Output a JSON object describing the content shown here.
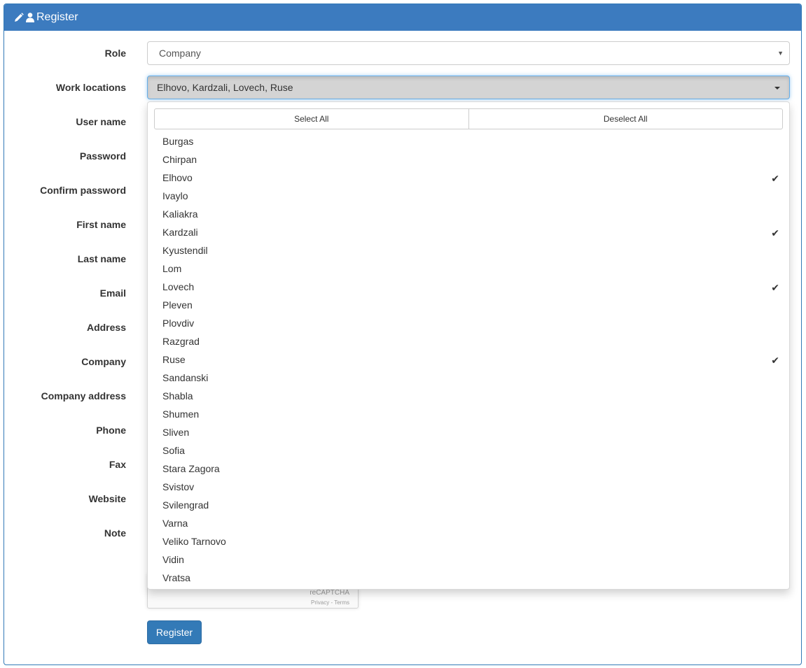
{
  "header": {
    "title": "Register",
    "icons": [
      "pencil-icon",
      "user-icon"
    ]
  },
  "form": {
    "role": {
      "label": "Role",
      "value": "Company"
    },
    "work_locations": {
      "label": "Work locations",
      "value": "Elhovo, Kardzali, Lovech, Ruse"
    },
    "labels": {
      "user_name": "User name",
      "password": "Password",
      "confirm_password": "Confirm password",
      "first_name": "First name",
      "last_name": "Last name",
      "email": "Email",
      "address": "Address",
      "company": "Company",
      "company_address": "Company address",
      "phone": "Phone",
      "fax": "Fax",
      "website": "Website",
      "note": "Note"
    },
    "submit_label": "Register"
  },
  "dropdown": {
    "select_all": "Select All",
    "deselect_all": "Deselect All",
    "options": [
      {
        "label": "Burgas",
        "selected": false
      },
      {
        "label": "Chirpan",
        "selected": false
      },
      {
        "label": "Elhovo",
        "selected": true
      },
      {
        "label": "Ivaylo",
        "selected": false
      },
      {
        "label": "Kaliakra",
        "selected": false
      },
      {
        "label": "Kardzali",
        "selected": true
      },
      {
        "label": "Kyustendil",
        "selected": false
      },
      {
        "label": "Lom",
        "selected": false
      },
      {
        "label": "Lovech",
        "selected": true
      },
      {
        "label": "Pleven",
        "selected": false
      },
      {
        "label": "Plovdiv",
        "selected": false
      },
      {
        "label": "Razgrad",
        "selected": false
      },
      {
        "label": "Ruse",
        "selected": true
      },
      {
        "label": "Sandanski",
        "selected": false
      },
      {
        "label": "Shabla",
        "selected": false
      },
      {
        "label": "Shumen",
        "selected": false
      },
      {
        "label": "Sliven",
        "selected": false
      },
      {
        "label": "Sofia",
        "selected": false
      },
      {
        "label": "Stara Zagora",
        "selected": false
      },
      {
        "label": "Svistov",
        "selected": false
      },
      {
        "label": "Svilengrad",
        "selected": false
      },
      {
        "label": "Varna",
        "selected": false
      },
      {
        "label": "Veliko Tarnovo",
        "selected": false
      },
      {
        "label": "Vidin",
        "selected": false
      },
      {
        "label": "Vratsa",
        "selected": false
      }
    ],
    "check_glyph": "✔"
  },
  "recaptcha": {
    "text": "reCAPTCHA",
    "links": "Privacy - Terms"
  },
  "colors": {
    "primary": "#337ab7",
    "header": "#3c7bbf",
    "selected_bg": "#d4d4d4"
  }
}
